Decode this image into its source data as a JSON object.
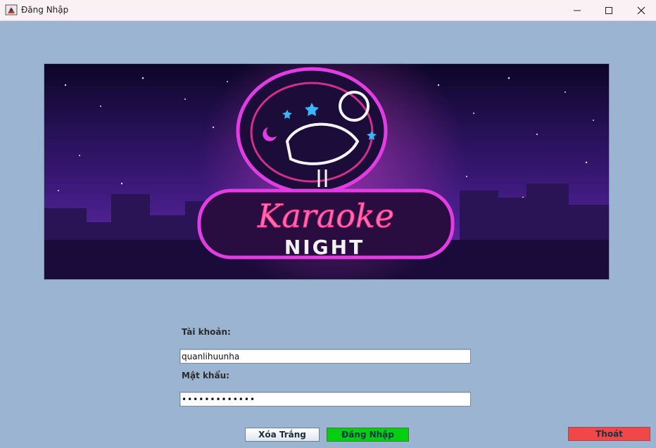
{
  "window": {
    "title": "Đăng Nhập",
    "icon": "java-app-icon"
  },
  "banner": {
    "headline": "Karaoke",
    "subline": "NIGHT"
  },
  "form": {
    "username_label": "Tài khoản:",
    "username_value": "quanlihuunha",
    "password_label": "Mật khẩu:",
    "password_value": "•••••••••••••"
  },
  "buttons": {
    "clear_label": "Xóa Trắng",
    "login_label": "Đăng Nhập",
    "exit_label": "Thoát"
  },
  "colors": {
    "background": "#9ab4d1",
    "login_button": "#00d010",
    "exit_button": "#f04848"
  }
}
